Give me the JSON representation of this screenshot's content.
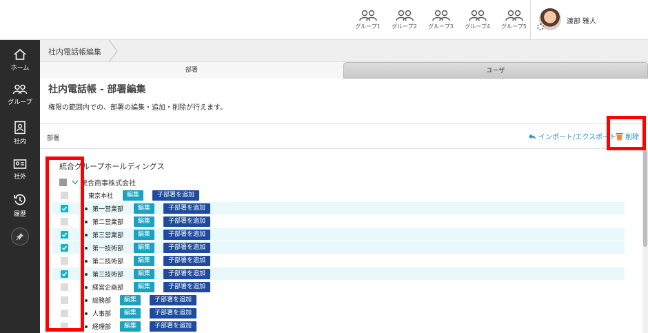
{
  "header": {
    "groups": [
      "グループ1",
      "グループ2",
      "グループ3",
      "グループ4",
      "グループ5"
    ],
    "user_name": "渡部 雅人"
  },
  "sidebar": {
    "items": [
      {
        "label": "ホーム",
        "icon": "home-icon"
      },
      {
        "label": "グループ",
        "icon": "group-icon"
      },
      {
        "label": "社内",
        "icon": "internal-contacts-icon"
      },
      {
        "label": "社外",
        "icon": "external-card-icon"
      },
      {
        "label": "履歴",
        "icon": "history-icon"
      }
    ],
    "pin_icon": "pin-icon"
  },
  "breadcrumb": {
    "current": "社内電話帳編集"
  },
  "tabs": {
    "dept": "部署",
    "user": "ユーザ"
  },
  "main": {
    "title": "社内電話帳 - 部署編集",
    "description": "権限の範囲内での、部署の編集・追加・削除が行えます。",
    "section_label": "部署",
    "import_export": "インポート/エクスポート",
    "delete": "削除"
  },
  "tree": {
    "root": "統合グループホールディングス",
    "company": "統合商事株式会社",
    "edit_label": "編集",
    "add_child_label": "子部署を追加",
    "departments": [
      {
        "name": "東京本社",
        "checked": false
      },
      {
        "name": "第一営業部",
        "checked": true
      },
      {
        "name": "第二営業部",
        "checked": false
      },
      {
        "name": "第三営業部",
        "checked": true
      },
      {
        "name": "第一技術部",
        "checked": true
      },
      {
        "name": "第二技術部",
        "checked": false
      },
      {
        "name": "第三技術部",
        "checked": true
      },
      {
        "name": "経営企画部",
        "checked": false
      },
      {
        "name": "総務部",
        "checked": false
      },
      {
        "name": "人事部",
        "checked": false
      },
      {
        "name": "経理部",
        "checked": false
      }
    ]
  },
  "colors": {
    "sidebar_bg": "#2b2b2b",
    "checkbox_on": "#18b2c6",
    "edit_button": "#1aa3c0",
    "add_button": "#1e4aa0",
    "link": "#2a8fc8",
    "row_highlight": "#e9f9fb",
    "annotation": "#ff0000"
  }
}
